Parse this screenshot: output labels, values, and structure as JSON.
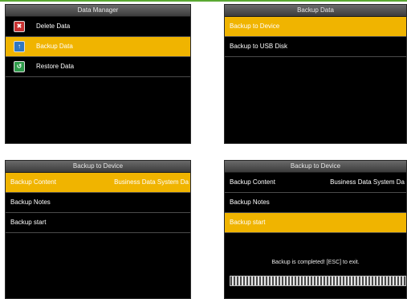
{
  "screen1": {
    "title": "Data Manager",
    "items": [
      {
        "label": "Delete Data",
        "icon": "delete-data-icon",
        "glyph": "✖",
        "selected": false
      },
      {
        "label": "Backup Data",
        "icon": "backup-data-icon",
        "glyph": "↑",
        "selected": true
      },
      {
        "label": "Restore Data",
        "icon": "restore-data-icon",
        "glyph": "↺",
        "selected": false
      }
    ]
  },
  "screen2": {
    "title": "Backup Data",
    "items": [
      {
        "label": "Backup to Device",
        "selected": true
      },
      {
        "label": "Backup to USB Disk",
        "selected": false
      }
    ]
  },
  "screen3": {
    "title": "Backup to Device",
    "rows": [
      {
        "label": "Backup Content",
        "value": "Business Data System Da",
        "selected": true
      },
      {
        "label": "Backup Notes",
        "value": "",
        "selected": false
      },
      {
        "label": "Backup start",
        "value": "",
        "selected": false
      }
    ]
  },
  "screen4": {
    "title": "Backup to Device",
    "rows": [
      {
        "label": "Backup Content",
        "value": "Business Data System Da",
        "selected": false
      },
      {
        "label": "Backup Notes",
        "value": "",
        "selected": false
      },
      {
        "label": "Backup start",
        "value": "",
        "selected": true
      }
    ],
    "status": "Backup is completed! [ESC] to exit.",
    "progress": 1.0
  },
  "colors": {
    "highlight": "#f0b400",
    "screen_bg": "#000000",
    "accent_line": "#5aa832"
  }
}
